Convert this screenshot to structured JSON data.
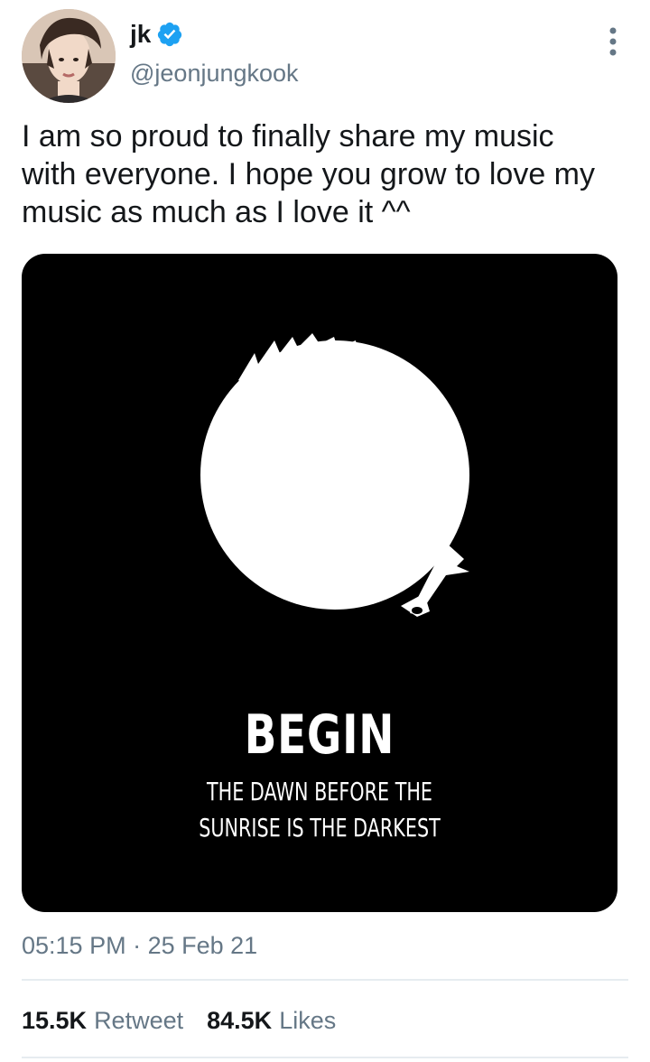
{
  "tweet": {
    "author": {
      "display_name": "jk",
      "handle": "@jeonjungkook",
      "verified": true,
      "verified_color": "#1da1f2"
    },
    "menu_icon": "more-vertical-icon",
    "text": "I am so proud to finally share my music\nwith everyone. I hope you grow to love my\nmusic as much as I love it ^^",
    "media": {
      "background": "#000000",
      "title": "BEGIN",
      "subtitle_line1": "THE DAWN BEFORE THE",
      "subtitle_line2": "SUNRISE IS THE DARKEST"
    },
    "time": "05:15 PM",
    "separator": "·",
    "date": "25 Feb 21",
    "stats": {
      "retweets_count": "15.5K",
      "retweets_label": "Retweet",
      "likes_count": "84.5K",
      "likes_label": "Likes"
    }
  },
  "colors": {
    "text_primary": "#14171a",
    "text_secondary": "#657786",
    "divider": "#e6ecf0"
  }
}
